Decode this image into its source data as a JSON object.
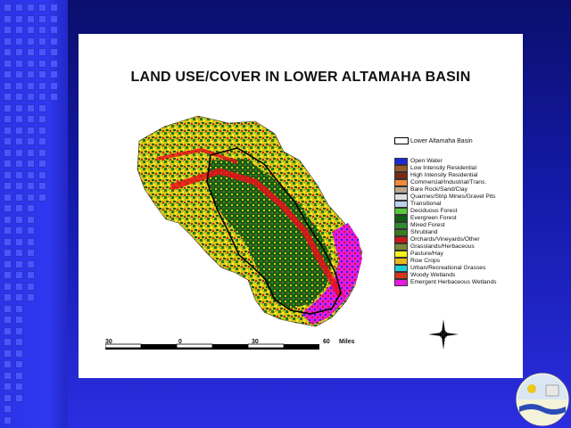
{
  "title": "LAND USE/COVER IN LOWER ALTAMAHA BASIN",
  "legend_basin": "Lower Altamaha Basin",
  "legend": [
    {
      "label": "Open Water",
      "color": "#1e2ad8"
    },
    {
      "label": "Low Intensity Residential",
      "color": "#9a5b2a"
    },
    {
      "label": "High Intensity Residential",
      "color": "#7a2a12"
    },
    {
      "label": "Commercial/Industrial/Trans.",
      "color": "#f08a3a"
    },
    {
      "label": "Bare Rock/Sand/Clay",
      "color": "#b9a78f"
    },
    {
      "label": "Quarries/Strip Mines/Gravel Pits",
      "color": "#e0e0e0"
    },
    {
      "label": "Transitional",
      "color": "#bcd0ee"
    },
    {
      "label": "Deciduous Forest",
      "color": "#59c83a"
    },
    {
      "label": "Evergreen Forest",
      "color": "#0f5e14"
    },
    {
      "label": "Mixed Forest",
      "color": "#2e8a2e"
    },
    {
      "label": "Shrubland",
      "color": "#3a7a20"
    },
    {
      "label": "Orchards/Vineyards/Other",
      "color": "#c81a1a"
    },
    {
      "label": "Grasslands/Herbaceous",
      "color": "#7a8a3a"
    },
    {
      "label": "Pasture/Hay",
      "color": "#f4f01c"
    },
    {
      "label": "Row Crops",
      "color": "#e8b81a"
    },
    {
      "label": "Urban/Recreational Grasses",
      "color": "#19d0d8"
    },
    {
      "label": "Woody Wetlands",
      "color": "#d8341c"
    },
    {
      "label": "Emergent Herbaceous Wetlands",
      "color": "#e81ae0"
    }
  ],
  "scale": {
    "ticks": [
      "30",
      "0",
      "30",
      "60"
    ],
    "unit": "Miles"
  }
}
